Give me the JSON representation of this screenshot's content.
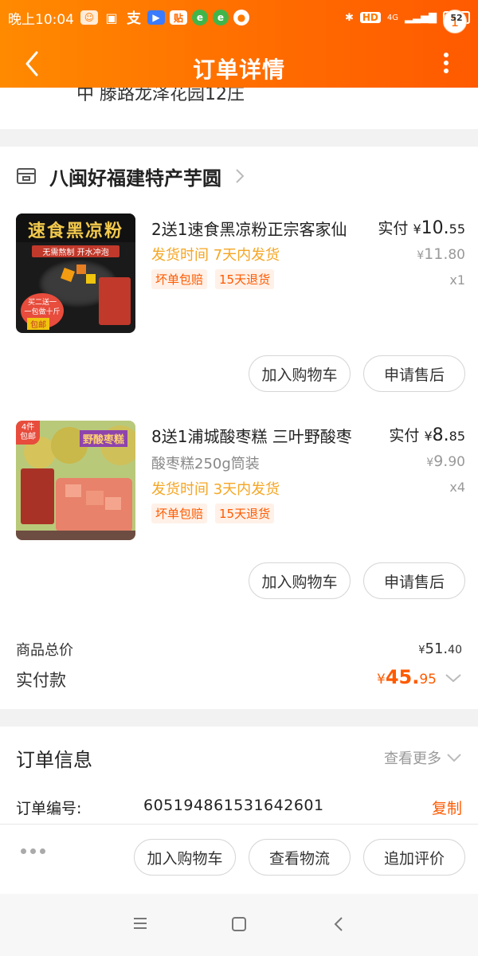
{
  "status_bar": {
    "time": "晚上10:04",
    "left_icons": [
      "alipay-icon",
      "desktop-icon",
      "zhi-icon",
      "video-icon",
      "tie-icon",
      "browser-icon",
      "browser-icon",
      "drop-icon"
    ],
    "tie_text": "贴",
    "zhi_text": "支",
    "network": "4G",
    "hd": "HD",
    "battery": "52"
  },
  "nav": {
    "title": "订单详情",
    "badge": "1"
  },
  "address_cut": "中 滕路龙泽花园12庄",
  "shop": {
    "name": "八闽好福建特产芋圆"
  },
  "items": [
    {
      "name": "2送1速食黑凉粉正宗客家仙",
      "sku": "",
      "ship": "发货时间  7天内发货",
      "tags": [
        "坏单包赔",
        "15天退货"
      ],
      "paid_label": "实付",
      "paid_currency": "¥",
      "paid_int": "10.",
      "paid_dec": "55",
      "orig_currency": "¥",
      "orig_int": "11.",
      "orig_dec": "80",
      "qty": "x1",
      "img_title": "速食黑凉粉",
      "img_sub": "无需熬制 开水冲泡",
      "img_promo": "买二送一",
      "img_promo2": "一包做十斤",
      "img_promo3": "包邮",
      "btn_cart": "加入购物车",
      "btn_after": "申请售后"
    },
    {
      "name": "8送1浦城酸枣糕 三叶野酸枣",
      "sku": "酸枣糕250g筒装",
      "ship": "发货时间  3天内发货",
      "tags": [
        "坏单包赔",
        "15天退货"
      ],
      "paid_label": "实付",
      "paid_currency": "¥",
      "paid_int": "8.",
      "paid_dec": "85",
      "orig_currency": "¥",
      "orig_int": "9.",
      "orig_dec": "90",
      "qty": "x4",
      "img_corner": "4件",
      "img_corner2": "包邮",
      "img_title": "野酸枣糕",
      "btn_cart": "加入购物车",
      "btn_after": "申请售后"
    }
  ],
  "totals": {
    "goods_label": "商品总价",
    "goods_currency": "¥",
    "goods_int": "51.",
    "goods_dec": "40",
    "paid_label": "实付款",
    "paid_currency": "¥",
    "paid_int": "45.",
    "paid_dec": "95"
  },
  "order_info": {
    "title": "订单信息",
    "see_more": "查看更多",
    "order_no_label": "订单编号:",
    "order_no": "605194861531642601",
    "copy": "复制"
  },
  "action_bar": {
    "cart": "加入购物车",
    "logistics": "查看物流",
    "review": "追加评价"
  },
  "colors": {
    "accent": "#ff6a00",
    "price": "#ff5a00",
    "ship": "#f5a623"
  }
}
